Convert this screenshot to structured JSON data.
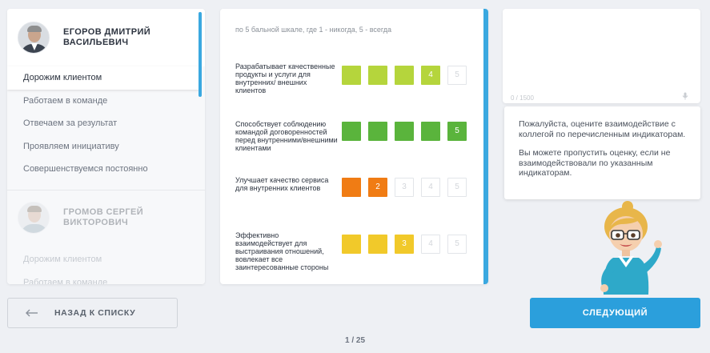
{
  "people": [
    {
      "name_line1": "ЕГОРОВ ДМИТРИЙ",
      "name_line2": "ВАСИЛЬЕВИЧ",
      "criteria": [
        "Дорожим клиентом",
        "Работаем в команде",
        "Отвечаем за результат",
        "Проявляем инициативу",
        "Совершенствуемся постоянно"
      ],
      "active_index": 0
    },
    {
      "name_line1": "ГРОМОВ СЕРГЕЙ",
      "name_line2": "ВИКТОРОВИЧ",
      "criteria": [
        "Дорожим клиентом",
        "Работаем в команде"
      ]
    }
  ],
  "rating": {
    "hint": "по 5 бальной шкале, где 1 - никогда, 5 - всегда",
    "questions": [
      {
        "label": "Разрабатывает качественные продукты и услуги для внутренних/ внешних клиентов",
        "score": 4,
        "color": "#b5d53c"
      },
      {
        "label": "Способствует соблюдению командой договоренностей перед внутренними/внешними клиентами",
        "score": 5,
        "color": "#5ab43c"
      },
      {
        "label": "Улучшает качество сервиса для внутренних клиентов",
        "score": 2,
        "color": "#f07c14"
      },
      {
        "label": "Эффективно взаимодействует для выстраивания отношений, вовлекает все заинтересованные стороны",
        "score": 3,
        "color": "#f1c92a"
      }
    ]
  },
  "comment": {
    "counter": "0 / 1500",
    "mic_icon": "microphone-icon"
  },
  "tip": {
    "p1": "Пожалуйста, оцените взаимодействие с коллегой по перечисленным индикаторам.",
    "p2": "Вы можете пропустить оценку, если не взаимодействовали по указанным индикаторам."
  },
  "nav": {
    "back_label": "НАЗАД К СПИСКУ",
    "next_label": "СЛЕДУЮЩИЙ",
    "pager": "1 / 25"
  },
  "colors": {
    "accent": "#2b9fdc",
    "scrollbar": "#3aa8e0"
  }
}
